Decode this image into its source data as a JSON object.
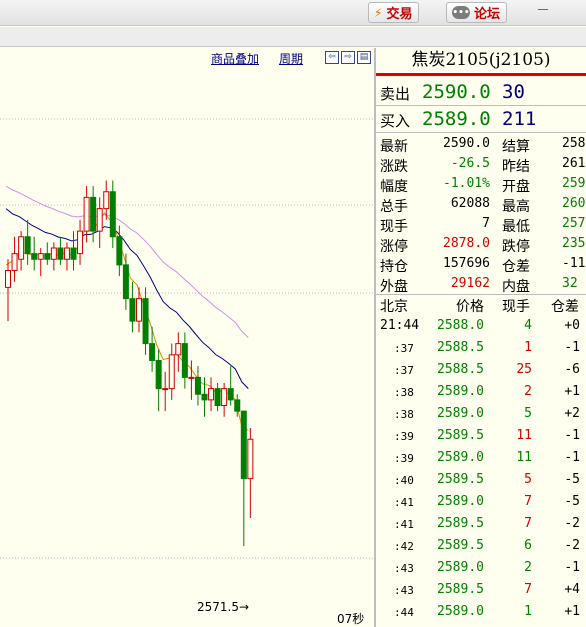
{
  "topbar": {
    "trade_label": "交易",
    "forum_label": "论坛",
    "minimize_label": "－"
  },
  "chart_toolbar": {
    "overlay_label": "商品叠加",
    "period_label": "周期"
  },
  "chart_data": {
    "type": "candlestick",
    "title": "",
    "xlabel": "",
    "ylabel": "",
    "ylim": [
      2566,
      2614
    ],
    "candles": [
      {
        "o": 2594.5,
        "h": 2597.0,
        "l": 2591.5,
        "c": 2596.0
      },
      {
        "o": 2596.0,
        "h": 2599.0,
        "l": 2595.0,
        "c": 2597.5
      },
      {
        "o": 2597.0,
        "h": 2599.5,
        "l": 2596.0,
        "c": 2599.0
      },
      {
        "o": 2599.0,
        "h": 2600.5,
        "l": 2596.5,
        "c": 2597.5
      },
      {
        "o": 2597.5,
        "h": 2599.0,
        "l": 2596.0,
        "c": 2597.0
      },
      {
        "o": 2597.0,
        "h": 2598.0,
        "l": 2595.5,
        "c": 2597.5
      },
      {
        "o": 2597.5,
        "h": 2598.5,
        "l": 2596.5,
        "c": 2597.0
      },
      {
        "o": 2597.0,
        "h": 2598.5,
        "l": 2596.0,
        "c": 2598.0
      },
      {
        "o": 2598.0,
        "h": 2599.0,
        "l": 2596.5,
        "c": 2597.0
      },
      {
        "o": 2597.0,
        "h": 2598.5,
        "l": 2596.0,
        "c": 2598.0
      },
      {
        "o": 2598.0,
        "h": 2599.5,
        "l": 2596.0,
        "c": 2597.0
      },
      {
        "o": 2597.5,
        "h": 2600.5,
        "l": 2596.5,
        "c": 2599.5
      },
      {
        "o": 2599.5,
        "h": 2603.5,
        "l": 2598.5,
        "c": 2602.5
      },
      {
        "o": 2602.5,
        "h": 2603.5,
        "l": 2598.5,
        "c": 2599.5
      },
      {
        "o": 2599.5,
        "h": 2602.5,
        "l": 2598.0,
        "c": 2601.5
      },
      {
        "o": 2601.5,
        "h": 2604.0,
        "l": 2600.5,
        "c": 2603.0
      },
      {
        "o": 2603.0,
        "h": 2604.0,
        "l": 2598.0,
        "c": 2599.0
      },
      {
        "o": 2599.0,
        "h": 2600.0,
        "l": 2595.5,
        "c": 2596.5
      },
      {
        "o": 2596.5,
        "h": 2597.5,
        "l": 2592.5,
        "c": 2593.5
      },
      {
        "o": 2593.5,
        "h": 2595.0,
        "l": 2590.5,
        "c": 2591.5
      },
      {
        "o": 2591.5,
        "h": 2594.5,
        "l": 2590.5,
        "c": 2593.5
      },
      {
        "o": 2593.5,
        "h": 2594.5,
        "l": 2588.5,
        "c": 2589.5
      },
      {
        "o": 2589.5,
        "h": 2591.0,
        "l": 2587.0,
        "c": 2588.0
      },
      {
        "o": 2588.0,
        "h": 2589.0,
        "l": 2583.5,
        "c": 2585.5
      },
      {
        "o": 2585.5,
        "h": 2587.0,
        "l": 2583.5,
        "c": 2585.5
      },
      {
        "o": 2585.5,
        "h": 2589.5,
        "l": 2584.5,
        "c": 2588.5
      },
      {
        "o": 2588.5,
        "h": 2590.5,
        "l": 2587.0,
        "c": 2589.5
      },
      {
        "o": 2589.5,
        "h": 2590.5,
        "l": 2585.5,
        "c": 2586.5
      },
      {
        "o": 2586.5,
        "h": 2588.0,
        "l": 2584.5,
        "c": 2586.5
      },
      {
        "o": 2586.5,
        "h": 2587.5,
        "l": 2584.0,
        "c": 2585.0
      },
      {
        "o": 2585.0,
        "h": 2586.5,
        "l": 2583.0,
        "c": 2584.5
      },
      {
        "o": 2584.5,
        "h": 2586.5,
        "l": 2583.5,
        "c": 2585.5
      },
      {
        "o": 2585.5,
        "h": 2586.0,
        "l": 2583.5,
        "c": 2584.0
      },
      {
        "o": 2584.0,
        "h": 2586.0,
        "l": 2583.0,
        "c": 2585.5
      },
      {
        "o": 2585.5,
        "h": 2587.5,
        "l": 2584.0,
        "c": 2584.5
      },
      {
        "o": 2584.5,
        "h": 2585.0,
        "l": 2583.0,
        "c": 2583.5
      },
      {
        "o": 2583.5,
        "h": 2583.5,
        "l": 2571.5,
        "c": 2577.5
      },
      {
        "o": 2577.5,
        "h": 2582.0,
        "l": 2574.0,
        "c": 2581.0
      }
    ],
    "annotations": [
      {
        "text": "2571.5→",
        "price": 2571.5
      }
    ],
    "timer_text": "07秒",
    "colors": {
      "up": "#d00000",
      "down": "#007f00",
      "ma_fast": "#e08a00",
      "ma_mid": "#000080",
      "ma_slow": "#e08ae0"
    }
  },
  "quote": {
    "title": "焦炭2105(j2105)",
    "ask": {
      "label": "卖出",
      "price": "2590.0",
      "volume": "30"
    },
    "bid": {
      "label": "买入",
      "price": "2589.0",
      "volume": "211"
    },
    "stats": [
      {
        "l1": "最新",
        "v1": "2590.0",
        "c1": "blk",
        "l2": "结算",
        "v2": "258",
        "c2": "blk"
      },
      {
        "l1": "涨跌",
        "v1": "-26.5",
        "c1": "green",
        "l2": "昨结",
        "v2": "261",
        "c2": "blk"
      },
      {
        "l1": "幅度",
        "v1": "-1.01%",
        "c1": "green",
        "l2": "开盘",
        "v2": "259",
        "c2": "green"
      },
      {
        "l1": "总手",
        "v1": "62088",
        "c1": "blk",
        "l2": "最高",
        "v2": "260",
        "c2": "green"
      },
      {
        "l1": "现手",
        "v1": "7",
        "c1": "blk",
        "l2": "最低",
        "v2": "257",
        "c2": "green"
      },
      {
        "l1": "涨停",
        "v1": "2878.0",
        "c1": "red",
        "l2": "跌停",
        "v2": "235",
        "c2": "green"
      },
      {
        "l1": "持仓",
        "v1": "157696",
        "c1": "blk",
        "l2": "仓差",
        "v2": "-11",
        "c2": "blk"
      },
      {
        "l1": "外盘",
        "v1": "29162",
        "c1": "red",
        "l2": "内盘",
        "v2": "32",
        "c2": "green"
      }
    ],
    "ticks_header": {
      "time": "北京",
      "price": "价格",
      "volume": "现手",
      "oi": "仓差"
    },
    "ticks": [
      {
        "time": "21:44",
        "price": "2588.0",
        "volume": "4",
        "vcolor": "green",
        "oi": "+0"
      },
      {
        "time": ":37",
        "price": "2588.5",
        "volume": "1",
        "vcolor": "red",
        "oi": "-1"
      },
      {
        "time": ":37",
        "price": "2588.5",
        "volume": "25",
        "vcolor": "red",
        "oi": "-6"
      },
      {
        "time": ":38",
        "price": "2589.0",
        "volume": "2",
        "vcolor": "red",
        "oi": "+1"
      },
      {
        "time": ":38",
        "price": "2589.0",
        "volume": "5",
        "vcolor": "green",
        "oi": "+2"
      },
      {
        "time": ":39",
        "price": "2589.5",
        "volume": "11",
        "vcolor": "red",
        "oi": "-1"
      },
      {
        "time": ":39",
        "price": "2589.0",
        "volume": "11",
        "vcolor": "green",
        "oi": "-1"
      },
      {
        "time": ":40",
        "price": "2589.5",
        "volume": "5",
        "vcolor": "red",
        "oi": "-5"
      },
      {
        "time": ":41",
        "price": "2589.0",
        "volume": "7",
        "vcolor": "red",
        "oi": "-5"
      },
      {
        "time": ":41",
        "price": "2589.5",
        "volume": "7",
        "vcolor": "red",
        "oi": "-2"
      },
      {
        "time": ":42",
        "price": "2589.5",
        "volume": "6",
        "vcolor": "green",
        "oi": "-2"
      },
      {
        "time": ":43",
        "price": "2589.0",
        "volume": "2",
        "vcolor": "green",
        "oi": "-1"
      },
      {
        "time": ":43",
        "price": "2589.5",
        "volume": "7",
        "vcolor": "red",
        "oi": "+4"
      },
      {
        "time": ":44",
        "price": "2589.0",
        "volume": "1",
        "vcolor": "green",
        "oi": "+1"
      }
    ]
  }
}
